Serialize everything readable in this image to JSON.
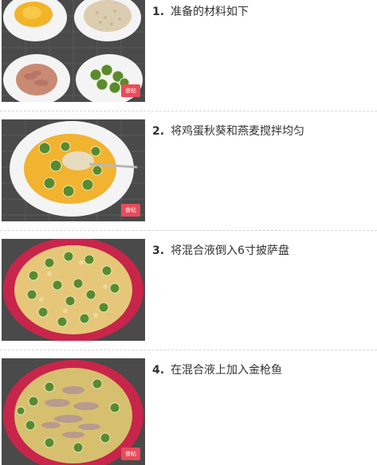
{
  "steps": [
    {
      "number": "1.",
      "text": "准备的材料如下"
    },
    {
      "number": "2.",
      "text": "将鸡蛋秋葵和燕麦搅拌均匀"
    },
    {
      "number": "3.",
      "text": "将混合液倒入6寸披萨盘"
    },
    {
      "number": "4.",
      "text": "在混合液上加入金枪鱼"
    }
  ],
  "watermark_text": "食帖",
  "colors": {
    "divider": "#d6d6d6",
    "text": "#333333",
    "watermark": "#e84c5a",
    "pizza_pan": "#c8254a",
    "egg_mix": "#e6c779",
    "okra": "#5a8a2e"
  }
}
